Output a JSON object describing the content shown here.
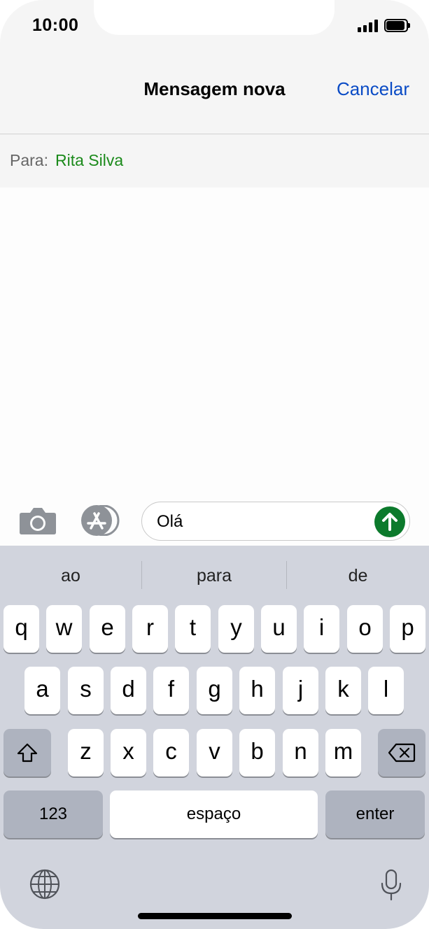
{
  "status_bar": {
    "time": "10:00"
  },
  "header": {
    "title": "Mensagem nova",
    "cancel_label": "Cancelar"
  },
  "recipient": {
    "label": "Para:",
    "name": "Rita Silva"
  },
  "composer": {
    "message_text": "Olá"
  },
  "keyboard": {
    "suggestions": [
      "ao",
      "para",
      "de"
    ],
    "row1": [
      "q",
      "w",
      "e",
      "r",
      "t",
      "y",
      "u",
      "i",
      "o",
      "p"
    ],
    "row2": [
      "a",
      "s",
      "d",
      "f",
      "g",
      "h",
      "j",
      "k",
      "l"
    ],
    "row3": [
      "z",
      "x",
      "c",
      "v",
      "b",
      "n",
      "m"
    ],
    "numbers_label": "123",
    "space_label": "espaço",
    "enter_label": "enter"
  },
  "colors": {
    "accent_blue": "#0a4bc5",
    "recipient_green": "#1b8a1b",
    "send_green": "#0c7a2c",
    "keyboard_bg": "#d1d4dd"
  },
  "icons": [
    "camera-icon",
    "app-store-icon",
    "send-arrow-icon",
    "shift-icon",
    "backspace-icon",
    "globe-icon",
    "microphone-icon"
  ]
}
